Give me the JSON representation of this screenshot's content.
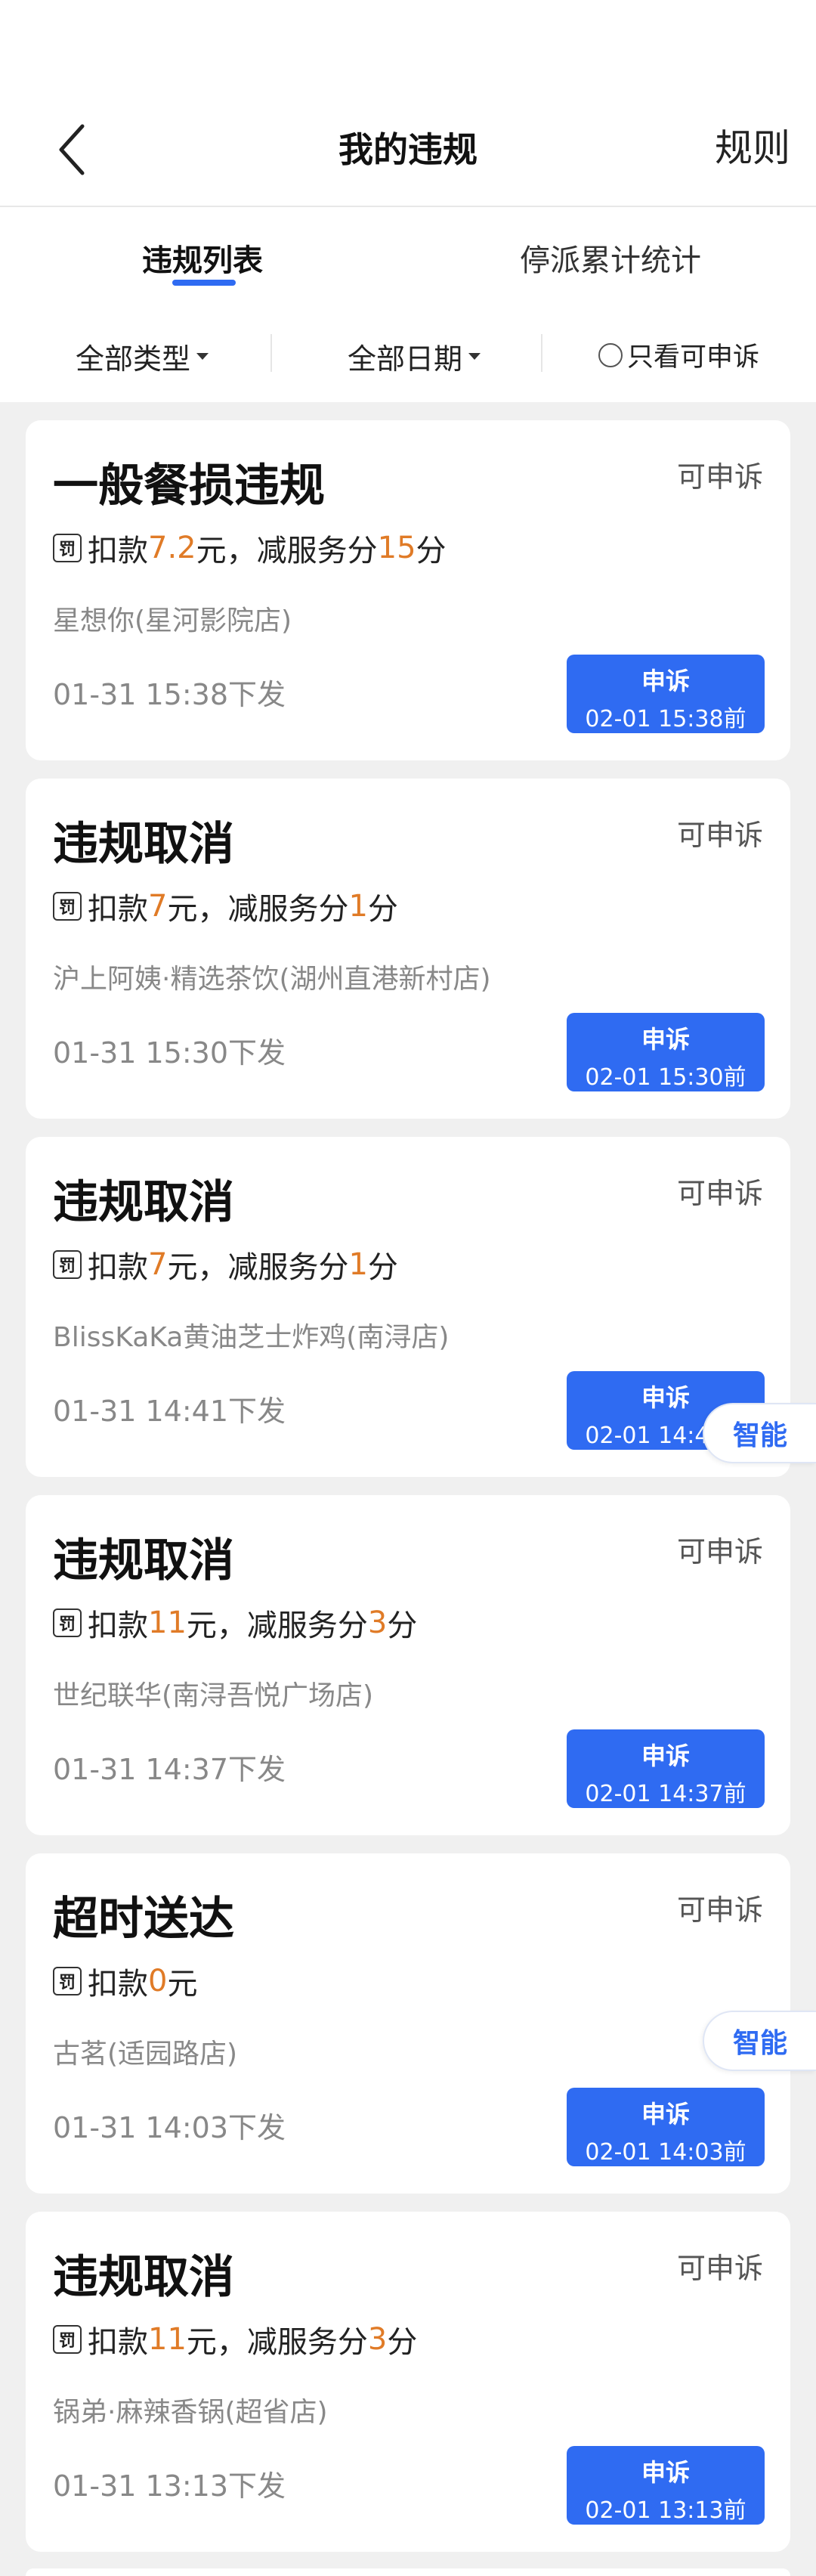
{
  "nav": {
    "title": "我的违规",
    "rules": "规则"
  },
  "tabs": [
    {
      "label": "违规列表",
      "active": true
    },
    {
      "label": "停派累计统计",
      "active": false
    }
  ],
  "filters": {
    "type": "全部类型",
    "date": "全部日期",
    "appealable_only": "只看可申诉"
  },
  "colors": {
    "accent": "#2f6bf2",
    "highlight": "#e07b27"
  },
  "smart_label": "智能",
  "cards": [
    {
      "title": "一般餐损违规",
      "status": "可申诉",
      "deduct_prefix": "扣款",
      "deduct": "7.2",
      "unit": "元",
      "sep": "，减服务分",
      "points": "15",
      "points_unit": "分",
      "shop": "星想你(星河影院店)",
      "issued": "01-31 15:38下发",
      "appeal": "申诉",
      "deadline": "02-01 15:38前"
    },
    {
      "title": "违规取消",
      "status": "可申诉",
      "deduct_prefix": "扣款",
      "deduct": "7",
      "unit": "元",
      "sep": "，减服务分",
      "points": "1",
      "points_unit": "分",
      "shop": "沪上阿姨·精选茶饮(湖州直港新村店)",
      "issued": "01-31 15:30下发",
      "appeal": "申诉",
      "deadline": "02-01 15:30前"
    },
    {
      "title": "违规取消",
      "status": "可申诉",
      "deduct_prefix": "扣款",
      "deduct": "7",
      "unit": "元",
      "sep": "，减服务分",
      "points": "1",
      "points_unit": "分",
      "shop": "BlissKaKa黄油芝士炸鸡(南浔店)",
      "issued": "01-31 14:41下发",
      "appeal": "申诉",
      "deadline": "02-01 14:41前"
    },
    {
      "title": "违规取消",
      "status": "可申诉",
      "deduct_prefix": "扣款",
      "deduct": "11",
      "unit": "元",
      "sep": "，减服务分",
      "points": "3",
      "points_unit": "分",
      "shop": "世纪联华(南浔吾悦广场店)",
      "issued": "01-31 14:37下发",
      "appeal": "申诉",
      "deadline": "02-01 14:37前"
    },
    {
      "title": "超时送达",
      "status": "可申诉",
      "deduct_prefix": "扣款",
      "deduct": "0",
      "unit": "元",
      "shop": "古茗(适园路店)",
      "issued": "01-31 14:03下发",
      "appeal": "申诉",
      "deadline": "02-01 14:03前"
    },
    {
      "title": "违规取消",
      "status": "可申诉",
      "deduct_prefix": "扣款",
      "deduct": "11",
      "unit": "元",
      "sep": "，减服务分",
      "points": "3",
      "points_unit": "分",
      "shop": "锅弟·麻辣香锅(超省店)",
      "issued": "01-31 13:13下发",
      "appeal": "申诉",
      "deadline": "02-01 13:13前"
    }
  ]
}
